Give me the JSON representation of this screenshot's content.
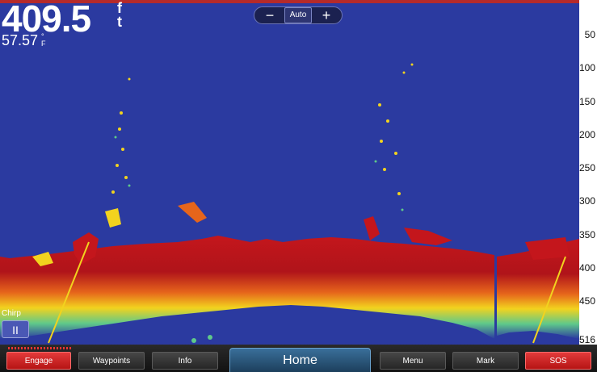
{
  "readout": {
    "depth": "409.5",
    "depth_unit_top": "f",
    "depth_unit_bottom": "t",
    "temperature": "57.57",
    "temp_unit_top": "°",
    "temp_unit_bottom": "F"
  },
  "zoom": {
    "minus": "−",
    "mode": "Auto",
    "plus": "+"
  },
  "scale": [
    "50",
    "100",
    "150",
    "200",
    "250",
    "300",
    "350",
    "400",
    "450",
    "516"
  ],
  "scale_max": 516,
  "chirp": {
    "label": "Chirp",
    "pause": "II"
  },
  "buttons": {
    "engage": "Engage",
    "waypoints": "Waypoints",
    "info": "Info",
    "home": "Home",
    "menu": "Menu",
    "mark": "Mark",
    "sos": "SOS"
  },
  "colors": {
    "water": "#2b3aa0",
    "bottom": "#b0141a",
    "accent_red": "#e33b3b"
  }
}
